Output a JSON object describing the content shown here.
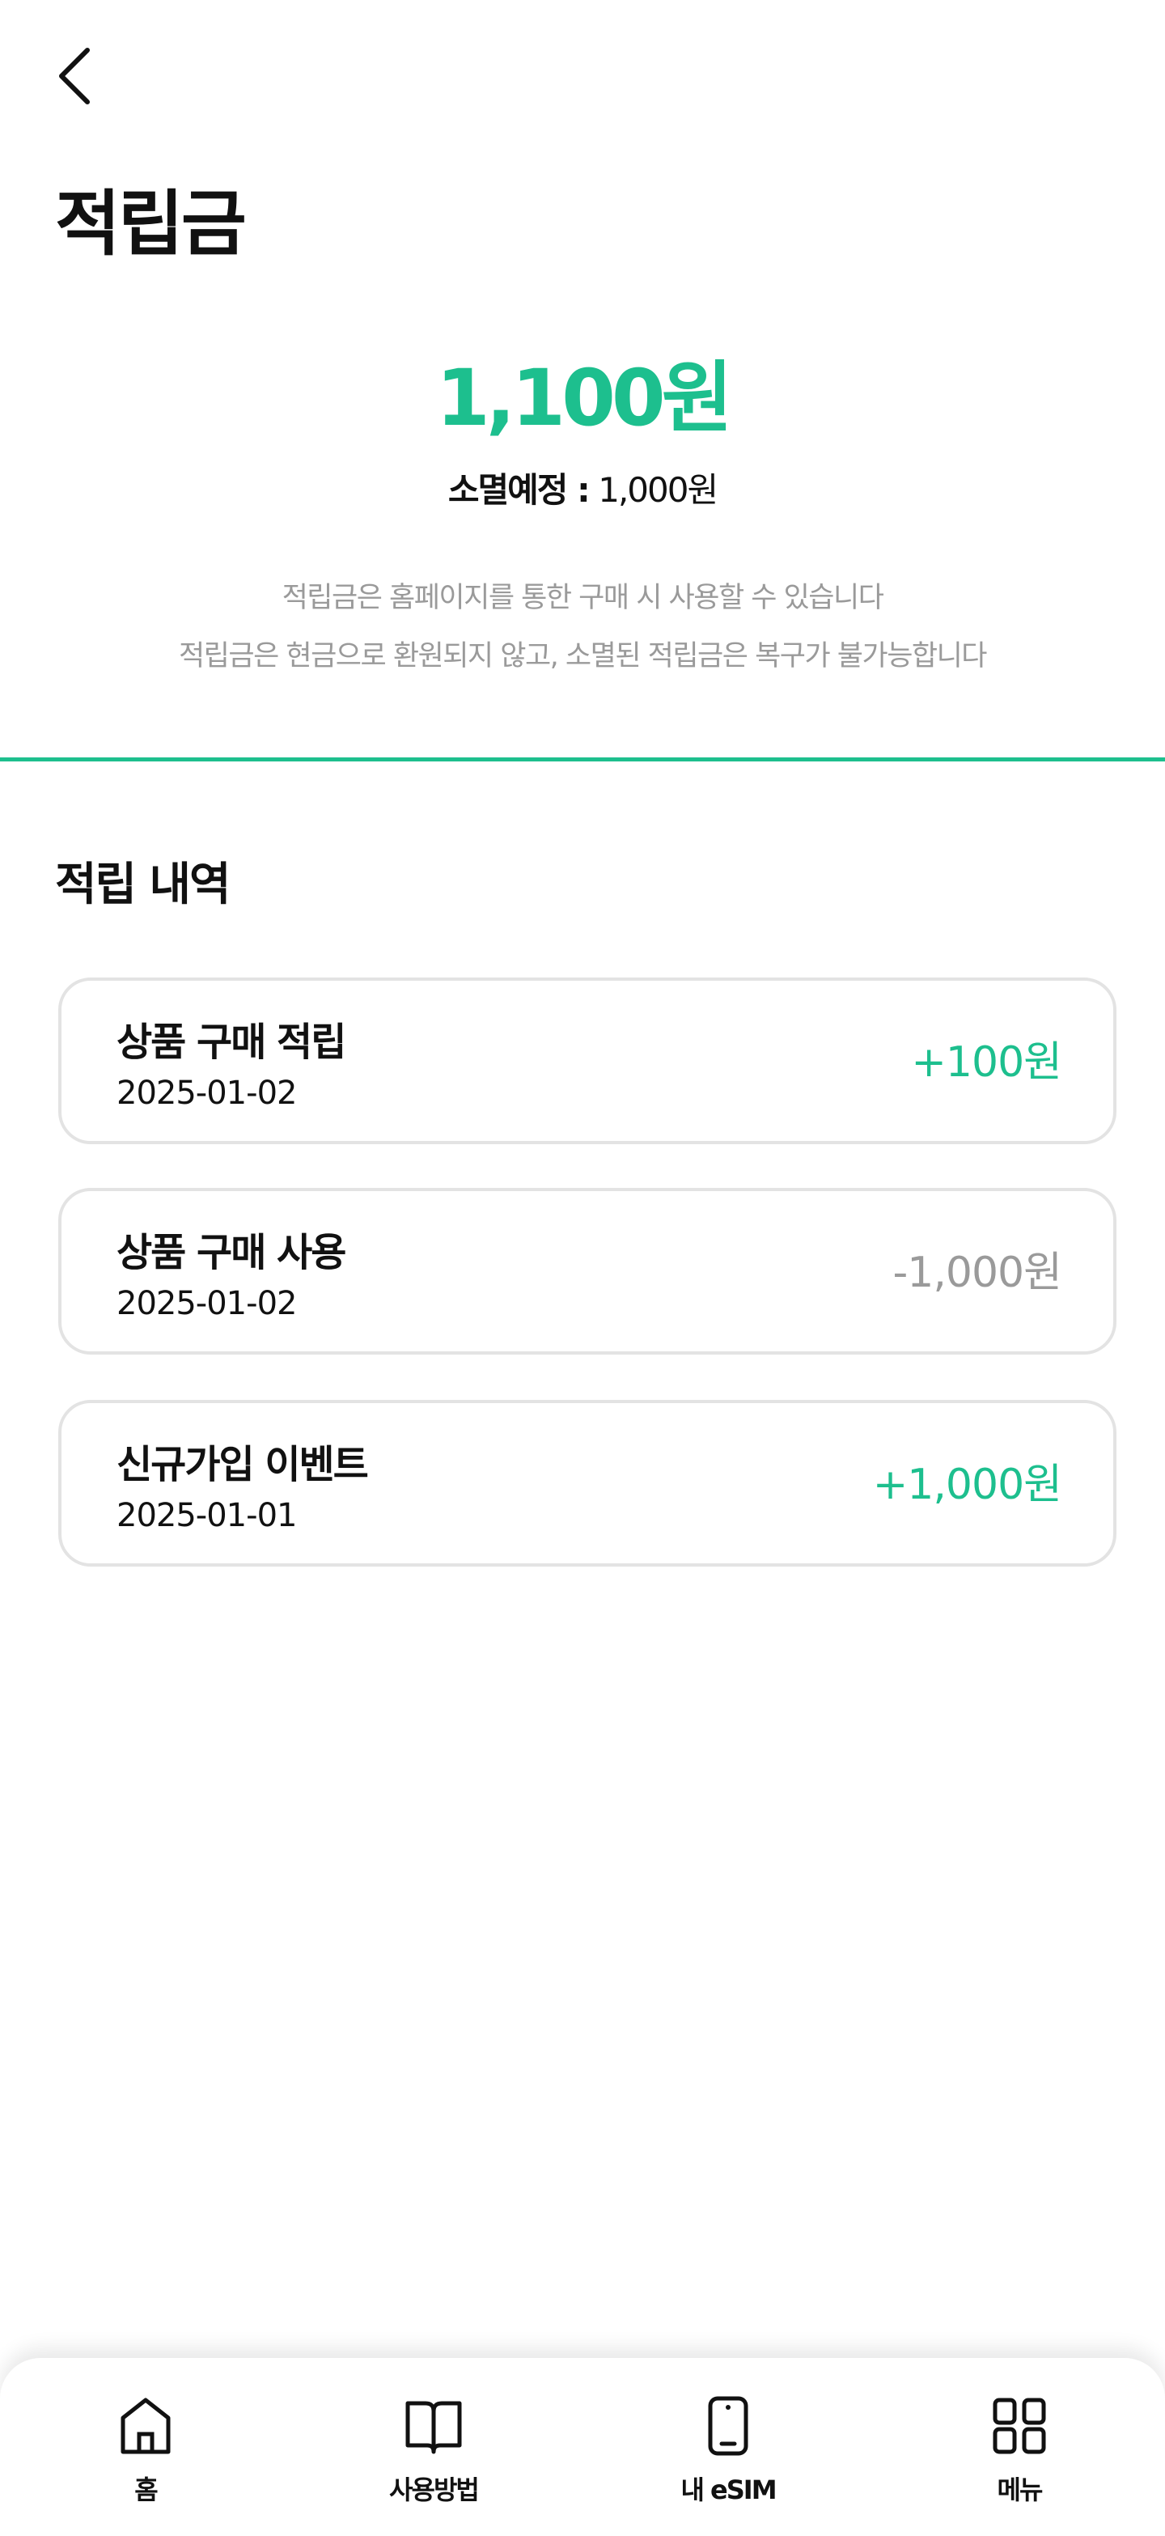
{
  "header": {
    "title": "적립금"
  },
  "balance": {
    "amount": "1,100원",
    "expire_label": "소멸예정 :",
    "expire_value": "1,000원",
    "notice_1": "적립금은 홈페이지를 통한 구매 시 사용할 수 있습니다",
    "notice_2": "적립금은 현금으로 환원되지 않고, 소멸된 적립금은 복구가 불가능합니다"
  },
  "history": {
    "title": "적립 내역",
    "items": [
      {
        "title": "상품 구매 적립",
        "date": "2025-01-02",
        "amount": "+100원",
        "type": "plus"
      },
      {
        "title": "상품 구매 사용",
        "date": "2025-01-02",
        "amount": "-1,000원",
        "type": "minus"
      },
      {
        "title": "신규가입 이벤트",
        "date": "2025-01-01",
        "amount": "+1,000원",
        "type": "plus"
      }
    ]
  },
  "nav": {
    "items": [
      {
        "label": "홈",
        "icon": "home-icon"
      },
      {
        "label": "사용방법",
        "icon": "book-icon"
      },
      {
        "label": "내 eSIM",
        "icon": "phone-icon"
      },
      {
        "label": "메뉴",
        "icon": "grid-icon"
      }
    ]
  },
  "colors": {
    "accent": "#1dbf8e",
    "minus": "#9a9a9a",
    "border": "#e3e3e3"
  }
}
